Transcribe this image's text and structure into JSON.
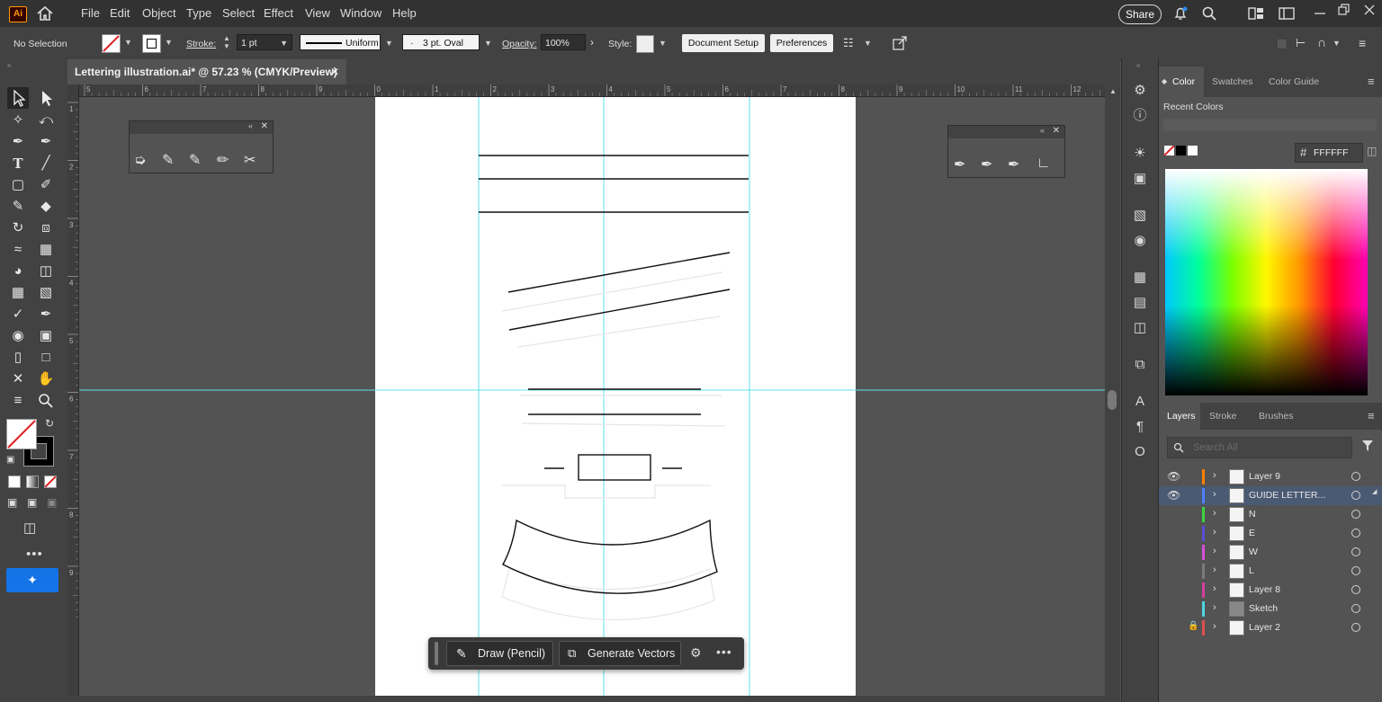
{
  "app": {
    "logo": "Ai",
    "menu": [
      "File",
      "Edit",
      "Object",
      "Type",
      "Select",
      "Effect",
      "View",
      "Window",
      "Help"
    ],
    "share_label": "Share"
  },
  "control_bar": {
    "selection": "No Selection",
    "stroke_label": "Stroke:",
    "stroke_weight": "1 pt",
    "profile": "Uniform",
    "brush": "3 pt. Oval",
    "opacity_label": "Opacity:",
    "opacity": "100%",
    "style_label": "Style:",
    "document_setup": "Document Setup",
    "preferences": "Preferences"
  },
  "document": {
    "tab_title": "Lettering illustration.ai* @ 57.23 % (CMYK/Preview)",
    "ruler_top_labels": [
      "5",
      "6",
      "7",
      "8",
      "9",
      "0",
      "1",
      "2",
      "3",
      "4",
      "5",
      "6",
      "7",
      "8",
      "9",
      "10",
      "11",
      "12"
    ],
    "ruler_left_labels": [
      "1",
      "2",
      "3",
      "4",
      "5",
      "6",
      "7",
      "8",
      "9"
    ]
  },
  "color_panel": {
    "tabs": [
      "Color",
      "Swatches",
      "Color Guide"
    ],
    "recent_colors_label": "Recent Colors",
    "hex_value": "FFFFFF"
  },
  "layers_panel": {
    "tabs": [
      "Layers",
      "Stroke",
      "Brushes"
    ],
    "search_placeholder": "Search All",
    "layers": [
      {
        "name": "Layer 9",
        "color": "#ff7f00",
        "visible": true,
        "locked": false
      },
      {
        "name": "GUIDE LETTER...",
        "color": "#4f7fff",
        "visible": true,
        "locked": false
      },
      {
        "name": "N",
        "color": "#3fd23f",
        "visible": false,
        "locked": false
      },
      {
        "name": "E",
        "color": "#5a4fd6",
        "visible": false,
        "locked": false
      },
      {
        "name": "W",
        "color": "#d64fd6",
        "visible": false,
        "locked": false
      },
      {
        "name": "L",
        "color": "#7a7a7a",
        "visible": false,
        "locked": false
      },
      {
        "name": "Layer 8",
        "color": "#d63f9f",
        "visible": false,
        "locked": false
      },
      {
        "name": "Sketch",
        "color": "#4fd6e0",
        "visible": false,
        "locked": false
      },
      {
        "name": "Layer 2",
        "color": "#e04f4f",
        "visible": false,
        "locked": true
      }
    ]
  },
  "contextual_bar": {
    "draw_label": "Draw (Pencil)",
    "generate_label": "Generate Vectors"
  }
}
